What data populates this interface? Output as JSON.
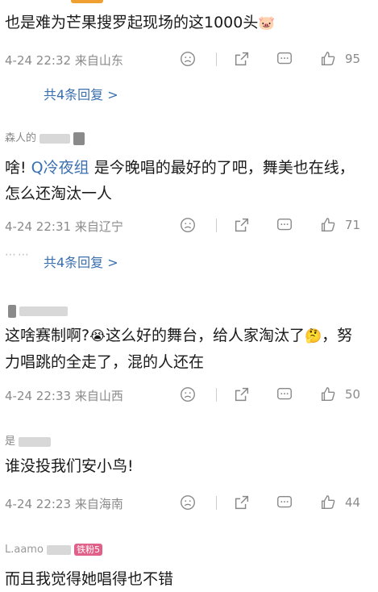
{
  "comments": [
    {
      "text": "也是难为芒果搜罗起现场的这1000头",
      "emoji": "🐷",
      "time": "4-24 22:32",
      "location": "来自山东",
      "likes": "95",
      "replies": "共4条回复 >"
    },
    {
      "username": "森人的",
      "text_before": "啥!",
      "mention": "Q冷夜组",
      "text_after": "是今晚唱的最好的了吧，舞美也在线，怎么还淘汰一人",
      "time": "4-24 22:31",
      "location": "来自辽宁",
      "likes": "71",
      "replies": "共4条回复 >"
    },
    {
      "text_1": "这啥赛制啊?",
      "emoji_1": "😭",
      "text_2": "这么好的舞台，给人家淘汰了",
      "emoji_2": "🤔",
      "text_3": "，努力唱跳的全走了，混的人还在",
      "time": "4-24 22:33",
      "location": "来自山西",
      "likes": "50"
    },
    {
      "username": "是",
      "text": "谁没投我们安小鸟!",
      "time": "4-24 22:23",
      "location": "来自海南",
      "likes": "44"
    },
    {
      "username": "L.aamo",
      "fan_badge": "铁粉5",
      "text": "而且我觉得她唱得也不错"
    }
  ],
  "icons": {
    "dislike": "sad-face-icon",
    "repost": "share-icon",
    "comment": "comment-icon",
    "like": "thumbs-up-icon"
  },
  "colors": {
    "link": "#3a6fb0",
    "meta": "#8a8a8a"
  }
}
